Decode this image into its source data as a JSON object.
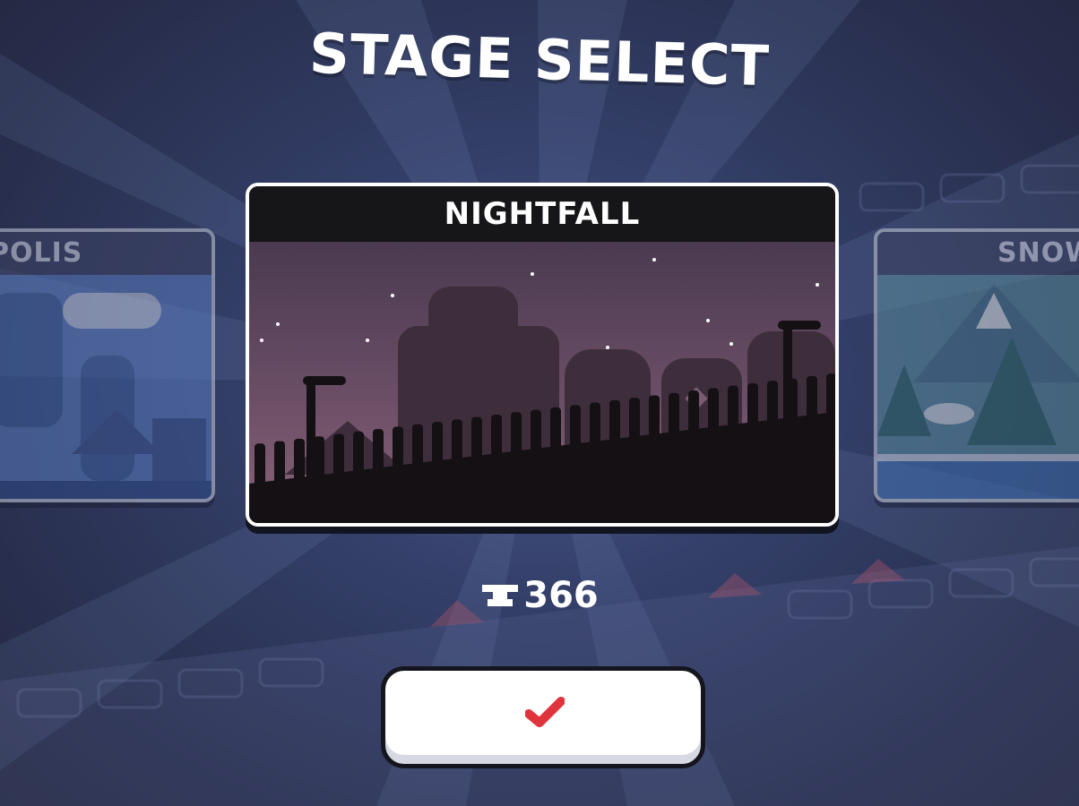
{
  "title": "STAGE SELECT",
  "stages": {
    "left": {
      "label": "POLIS"
    },
    "center": {
      "label": "NIGHTFALL"
    },
    "right": {
      "label": "SNOW"
    }
  },
  "price": {
    "icon": "anvil-icon",
    "value": "366"
  },
  "confirm": {
    "icon": "checkmark-icon",
    "color": "#e0343d"
  },
  "colors": {
    "background": "#2a3150",
    "card_border": "#ffffff",
    "night_sky": "#5a4256",
    "polis_tint": "#4a6aa8",
    "snow_tint": "#4f7f90"
  }
}
